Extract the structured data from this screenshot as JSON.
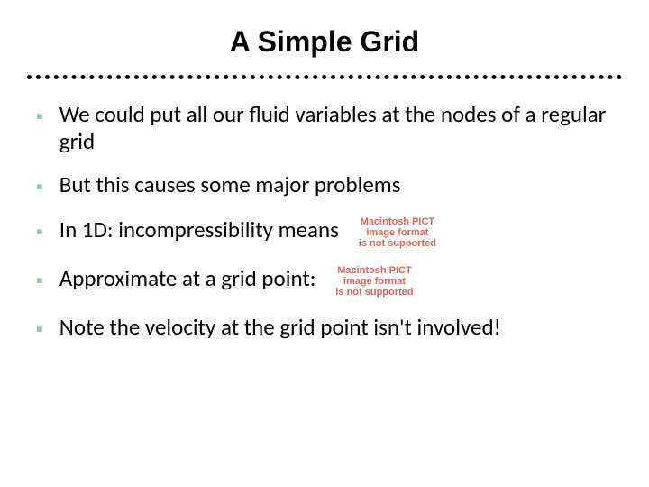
{
  "slide": {
    "title": "A Simple Grid",
    "bullets": [
      {
        "text": "We could put all our fluid variables at the nodes of a regular grid",
        "pict": false
      },
      {
        "text": "But this causes some major problems",
        "pict": false
      },
      {
        "text": "In 1D: incompressibility means",
        "pict": true
      },
      {
        "text": "Approximate at a grid point:",
        "pict": true
      },
      {
        "text": "Note the velocity at the grid point isn't involved!",
        "pict": false
      }
    ],
    "pict_placeholder": {
      "line1": "Macintosh PICT",
      "line2": "image format",
      "line3": "is not supported"
    }
  }
}
